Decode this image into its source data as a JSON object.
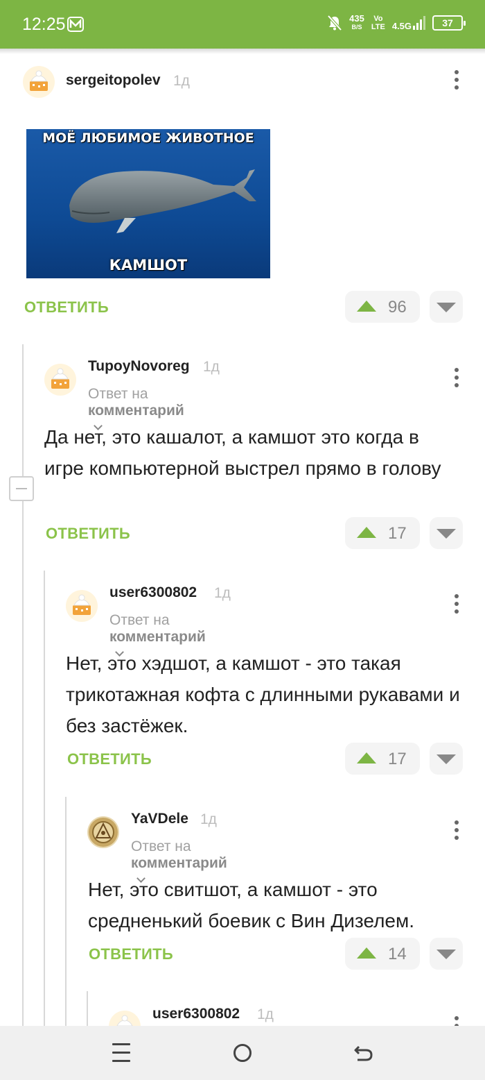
{
  "status_bar": {
    "time": "12:25",
    "net_speed": "435",
    "net_unit": "B/S",
    "volte_top": "Vo",
    "volte_bottom": "LTE",
    "network": "4.5G",
    "battery": "37"
  },
  "comments": [
    {
      "author": "sergeitopolev",
      "time": "1д",
      "image": {
        "caption_top": "МОЁ ЛЮБИМОЕ ЖИВОТНОЕ",
        "caption_bottom": "КАМШОТ"
      },
      "reply_label": "ОТВЕТИТЬ",
      "votes": "96"
    },
    {
      "author": "TupoyNovoreg",
      "time": "1д",
      "reply_to_prefix": "Ответ на",
      "reply_to_target": "комментарий",
      "text": "Да нет, это кашалот, а камшот это когда в игре компьютерной выстрел прямо в голову",
      "reply_label": "ОТВЕТИТЬ",
      "votes": "17"
    },
    {
      "author": "user6300802",
      "time": "1д",
      "reply_to_prefix": "Ответ на",
      "reply_to_target": "комментарий",
      "text": "Нет, это хэдшот, а камшот - это такая трикотажная кофта с длинными рукавами и без застёжек.",
      "reply_label": "ОТВЕТИТЬ",
      "votes": "17"
    },
    {
      "author": "YaVDele",
      "time": "1д",
      "reply_to_prefix": "Ответ на",
      "reply_to_target": "комментарий",
      "text": "Нет, это свитшот, а камшот - это средненький боевик с Вин Дизелем.",
      "reply_label": "ОТВЕТИТЬ",
      "votes": "14"
    },
    {
      "author": "user6300802",
      "time": "1д"
    }
  ],
  "colors": {
    "accent": "#7db544",
    "reply": "#8bc34a"
  }
}
